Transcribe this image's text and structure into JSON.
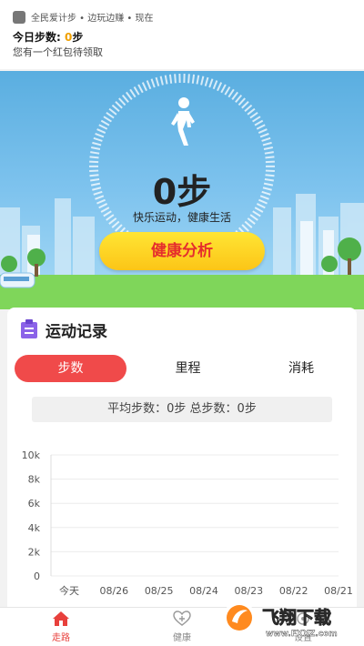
{
  "notification": {
    "app_line": "全民爱计步 • 边玩边赚 • 现在",
    "title_prefix": "今日步数: ",
    "title_steps": "0",
    "title_suffix": "步",
    "body": "您有一个红包待领取"
  },
  "hero": {
    "steps": "0步",
    "slogan": "快乐运动，健康生活",
    "analysis_button": "健康分析"
  },
  "record": {
    "title": "运动记录",
    "tabs": [
      {
        "label": "步数",
        "active": true
      },
      {
        "label": "里程",
        "active": false
      },
      {
        "label": "消耗",
        "active": false
      }
    ],
    "summary": "平均步数：0步 总步数：0步"
  },
  "chart_data": {
    "type": "line",
    "categories": [
      "今天",
      "08/26",
      "08/25",
      "08/24",
      "08/23",
      "08/22",
      "08/21"
    ],
    "series": [
      {
        "values": [
          0,
          0,
          0,
          0,
          0,
          0,
          0
        ]
      }
    ],
    "yticks": [
      "0",
      "2k",
      "4k",
      "6k",
      "8k",
      "10k"
    ],
    "ylim": [
      0,
      10000
    ],
    "grid": true
  },
  "tabbar": {
    "items": [
      {
        "label": "走路",
        "icon": "home-icon",
        "active": true
      },
      {
        "label": "健康",
        "icon": "health-icon",
        "active": false
      },
      {
        "label": "设置",
        "icon": "settings-icon",
        "active": false
      }
    ]
  },
  "watermark": {
    "text": "飞翔下载",
    "url": "www.FXXZ.com"
  },
  "colors": {
    "accent": "#f04a4a",
    "button_yellow": "#fdd21f",
    "sky": "#6fbbe9",
    "grass": "#7fd65a"
  }
}
